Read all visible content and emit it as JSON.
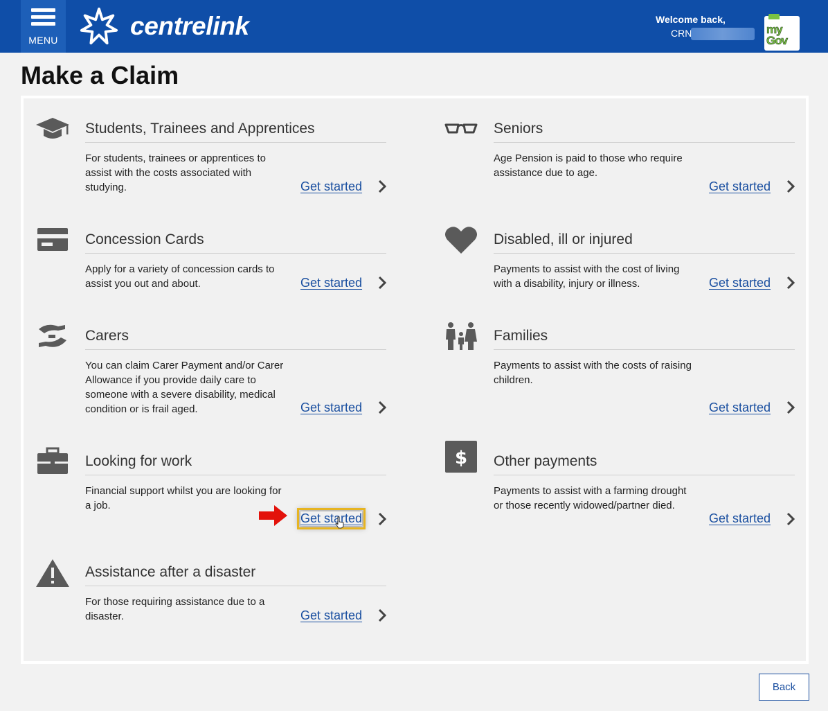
{
  "header": {
    "menu_label": "MENU",
    "brand": "centrelink",
    "welcome_line": "Welcome back,",
    "crn_label": "CRN",
    "mygov_line1": "my",
    "mygov_line2": "Gov"
  },
  "page": {
    "title": "Make a Claim"
  },
  "claims": [
    {
      "id": "students",
      "title": "Students, Trainees and Apprentices",
      "description": "For students, trainees or apprentices to assist with the costs associated with studying.",
      "action": "Get started",
      "icon": "graduation-cap-icon"
    },
    {
      "id": "seniors",
      "title": "Seniors",
      "description": "Age Pension is paid to those who require assistance due to age.",
      "action": "Get started",
      "icon": "glasses-icon"
    },
    {
      "id": "concession",
      "title": "Concession Cards",
      "description": "Apply for a variety of concession cards to assist you out and about.",
      "action": "Get started",
      "icon": "card-icon"
    },
    {
      "id": "disabled",
      "title": "Disabled, ill or injured",
      "description": "Payments to assist with the cost of living with a disability, injury or illness.",
      "action": "Get started",
      "icon": "heart-icon"
    },
    {
      "id": "carers",
      "title": "Carers",
      "description": "You can claim Carer Payment and/or Carer Allowance if you provide daily care to someone with a severe disability, medical condition or is frail aged.",
      "action": "Get started",
      "icon": "caring-hands-icon"
    },
    {
      "id": "families",
      "title": "Families",
      "description": "Payments to assist with the costs of raising children.",
      "action": "Get started",
      "icon": "family-icon"
    },
    {
      "id": "work",
      "title": "Looking for work",
      "description": "Financial support whilst you are looking for a job.",
      "action": "Get started",
      "icon": "briefcase-icon"
    },
    {
      "id": "other",
      "title": "Other payments",
      "description": "Payments to assist with a farming drought or those recently widowed/partner died.",
      "action": "Get started",
      "icon": "dollar-icon"
    },
    {
      "id": "disaster",
      "title": "Assistance after a disaster",
      "description": "For those requiring assistance due to a disaster.",
      "action": "Get started",
      "icon": "warning-icon"
    }
  ],
  "footer": {
    "back_label": "Back"
  },
  "colors": {
    "header_bg": "#0f4ea8",
    "link": "#1a4fa0",
    "focus_outline": "#e6b422",
    "annotation_arrow": "#e3120b"
  }
}
